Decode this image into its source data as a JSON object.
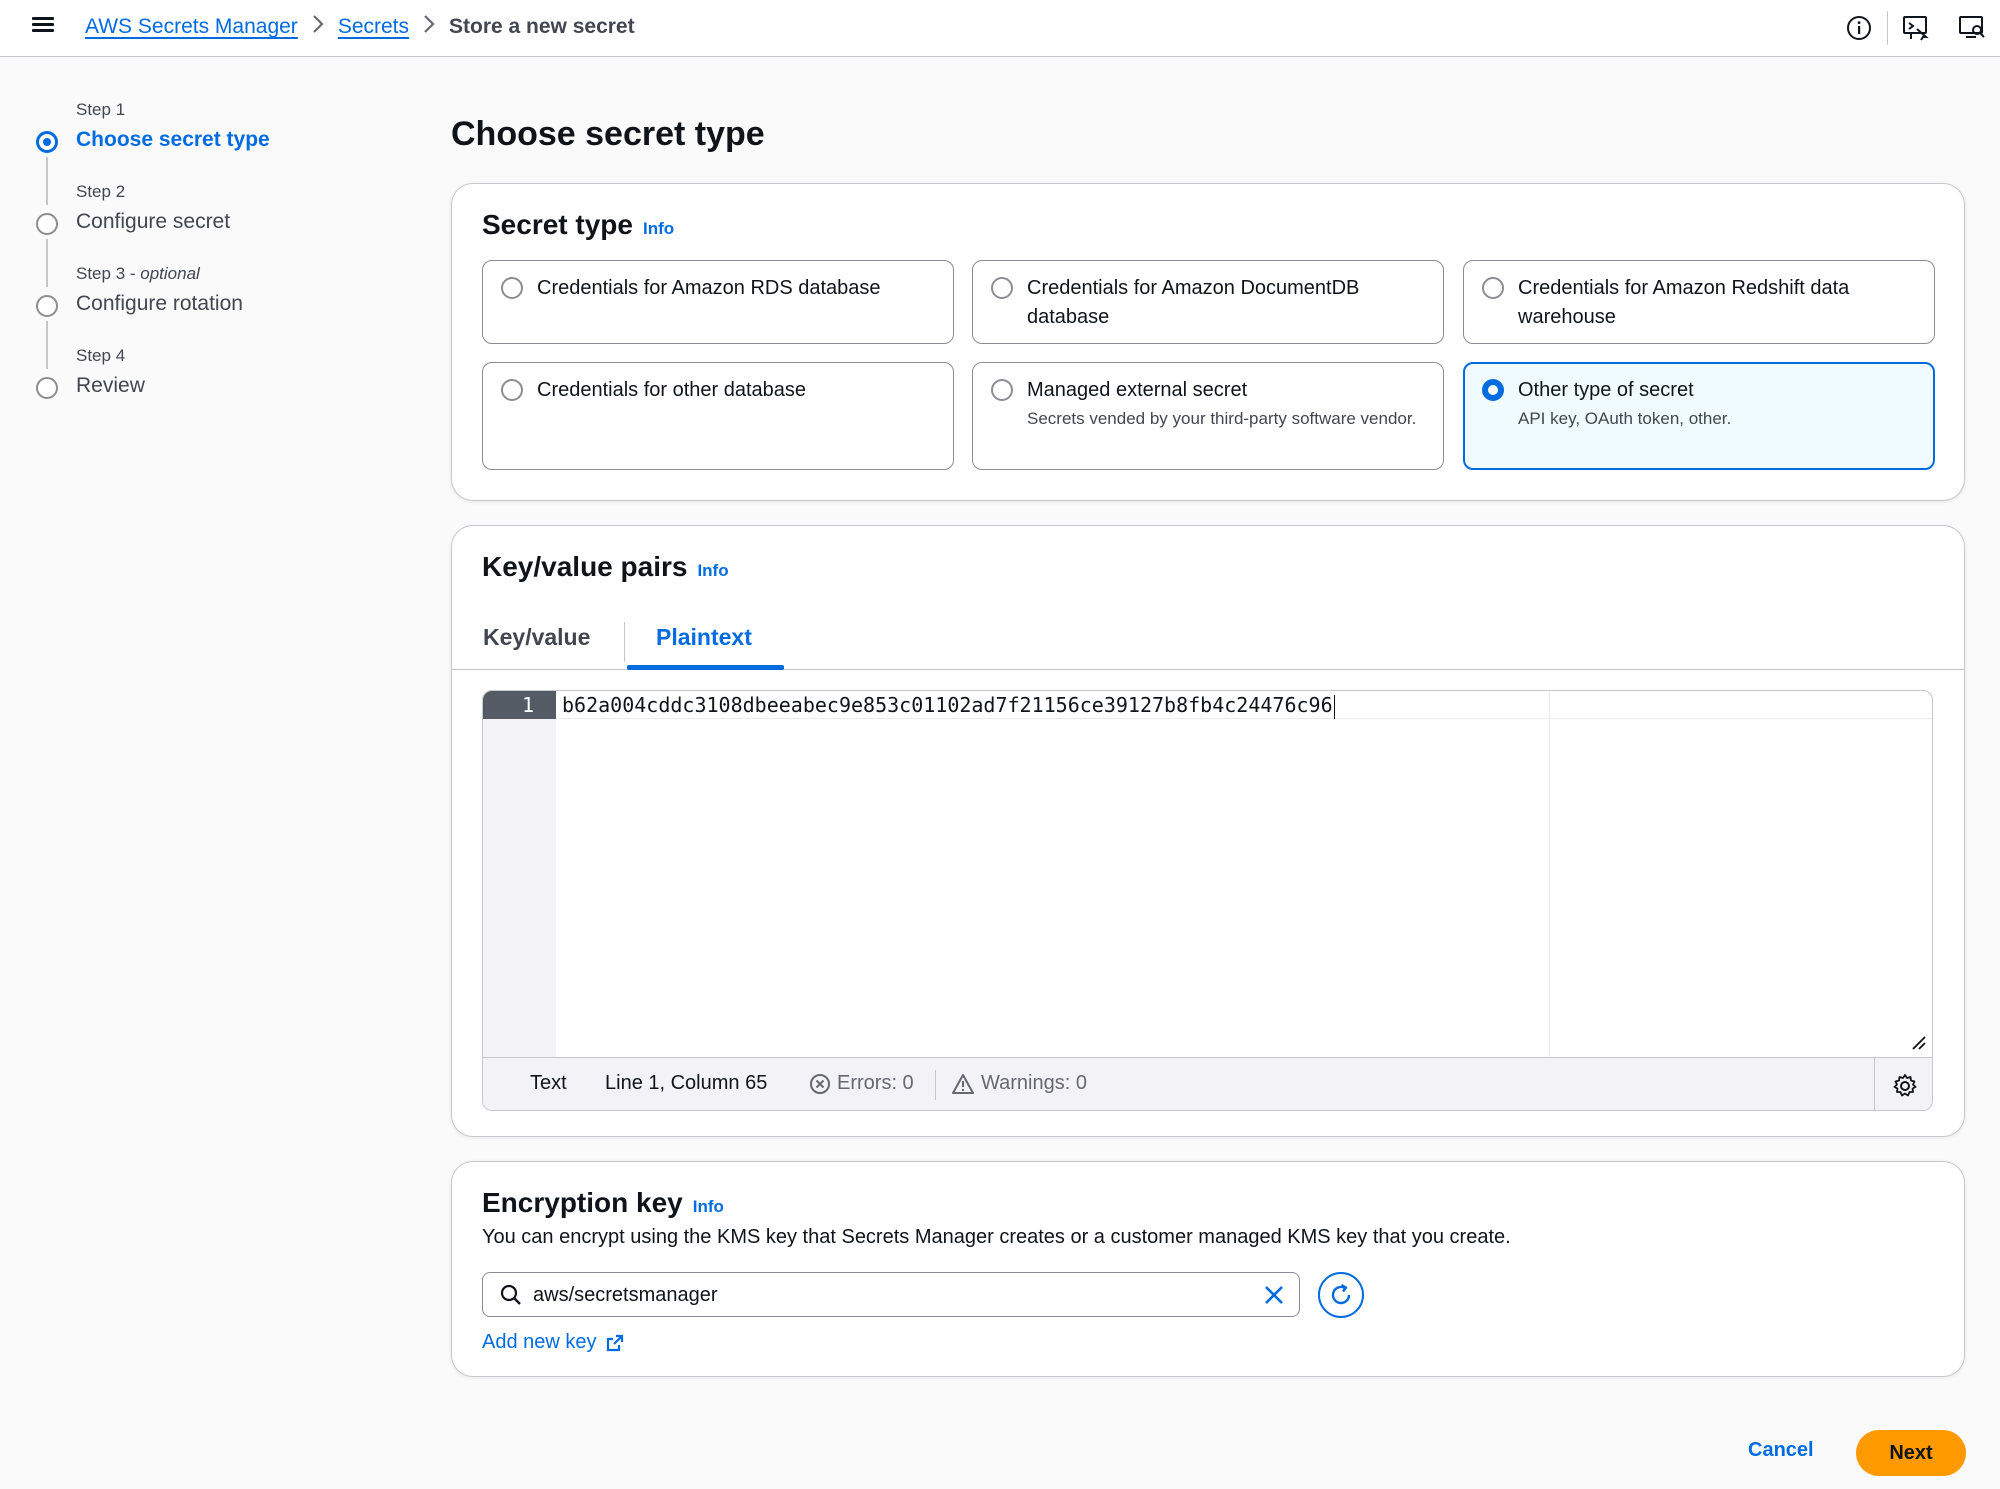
{
  "breadcrumb": {
    "items": [
      "AWS Secrets Manager",
      "Secrets"
    ],
    "current": "Store a new secret"
  },
  "steps": [
    {
      "num": "Step 1",
      "optional": "",
      "label": "Choose secret type",
      "active": true
    },
    {
      "num": "Step 2",
      "optional": "",
      "label": "Configure secret",
      "active": false
    },
    {
      "num": "Step 3",
      "optional": "optional",
      "label": "Configure rotation",
      "active": false
    },
    {
      "num": "Step 4",
      "optional": "",
      "label": "Review",
      "active": false
    }
  ],
  "page_title": "Choose secret type",
  "secret_type": {
    "title": "Secret type",
    "info": "Info",
    "options": [
      {
        "label": "Credentials for Amazon RDS database",
        "desc": "",
        "selected": false
      },
      {
        "label": "Credentials for Amazon DocumentDB database",
        "desc": "",
        "selected": false
      },
      {
        "label": "Credentials for Amazon Redshift data warehouse",
        "desc": "",
        "selected": false
      },
      {
        "label": "Credentials for other database",
        "desc": "",
        "selected": false
      },
      {
        "label": "Managed external secret",
        "desc": "Secrets vended by your third-party software vendor.",
        "selected": false
      },
      {
        "label": "Other type of secret",
        "desc": "API key, OAuth token, other.",
        "selected": true
      }
    ]
  },
  "kv": {
    "title": "Key/value pairs",
    "info": "Info",
    "tabs": [
      "Key/value",
      "Plaintext"
    ],
    "active_tab": "Plaintext",
    "editor": {
      "line_number": "1",
      "code": "b62a004cddc3108dbeeabec9e853c01102ad7f21156ce39127b8fb4c24476c96",
      "status_mode": "Text",
      "status_position": "Line 1, Column 65",
      "errors": "Errors: 0",
      "warnings": "Warnings: 0"
    }
  },
  "encryption": {
    "title": "Encryption key",
    "info": "Info",
    "description": "You can encrypt using the KMS key that Secrets Manager creates or a customer managed KMS key that you create.",
    "value": "aws/secretsmanager",
    "add_key": "Add new key"
  },
  "footer": {
    "cancel": "Cancel",
    "next": "Next"
  },
  "colors": {
    "accent": "#006ce0",
    "primary_button": "#ff9900"
  }
}
